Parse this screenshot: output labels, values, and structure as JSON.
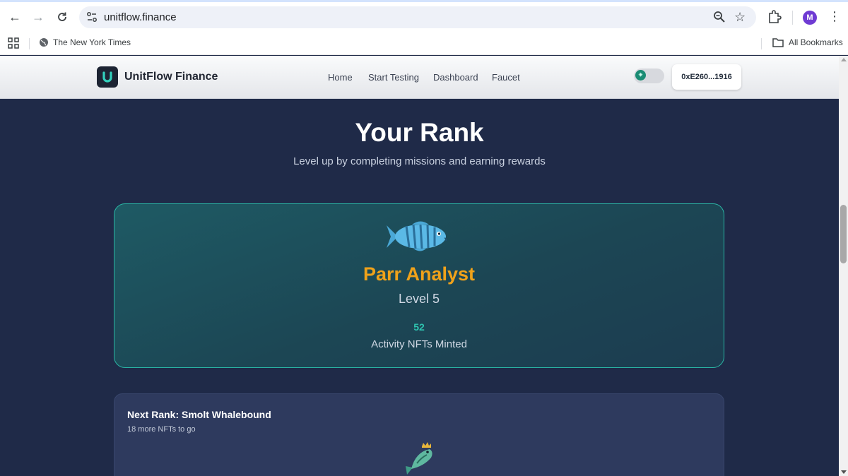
{
  "browser": {
    "url": "unitflow.finance",
    "bookmarks": [
      {
        "label": "The New York Times"
      }
    ],
    "all_bookmarks_label": "All Bookmarks",
    "profile_initial": "M"
  },
  "site": {
    "brand": "UnitFlow Finance",
    "nav": [
      "Home",
      "Start Testing",
      "Dashboard",
      "Faucet"
    ],
    "wallet": "0xE260...1916"
  },
  "rank": {
    "title": "Your Rank",
    "subtitle": "Level up by completing missions and earning rewards",
    "name": "Parr Analyst",
    "level": "Level 5",
    "nft_count": "52",
    "nft_label": "Activity NFTs Minted"
  },
  "next_rank": {
    "title": "Next Rank: Smolt Whalebound",
    "subtitle": "18 more NFTs to go"
  },
  "colors": {
    "accent_orange": "#f0a21a",
    "accent_teal": "#2ec4b0",
    "page_bg": "#1f2a48"
  }
}
